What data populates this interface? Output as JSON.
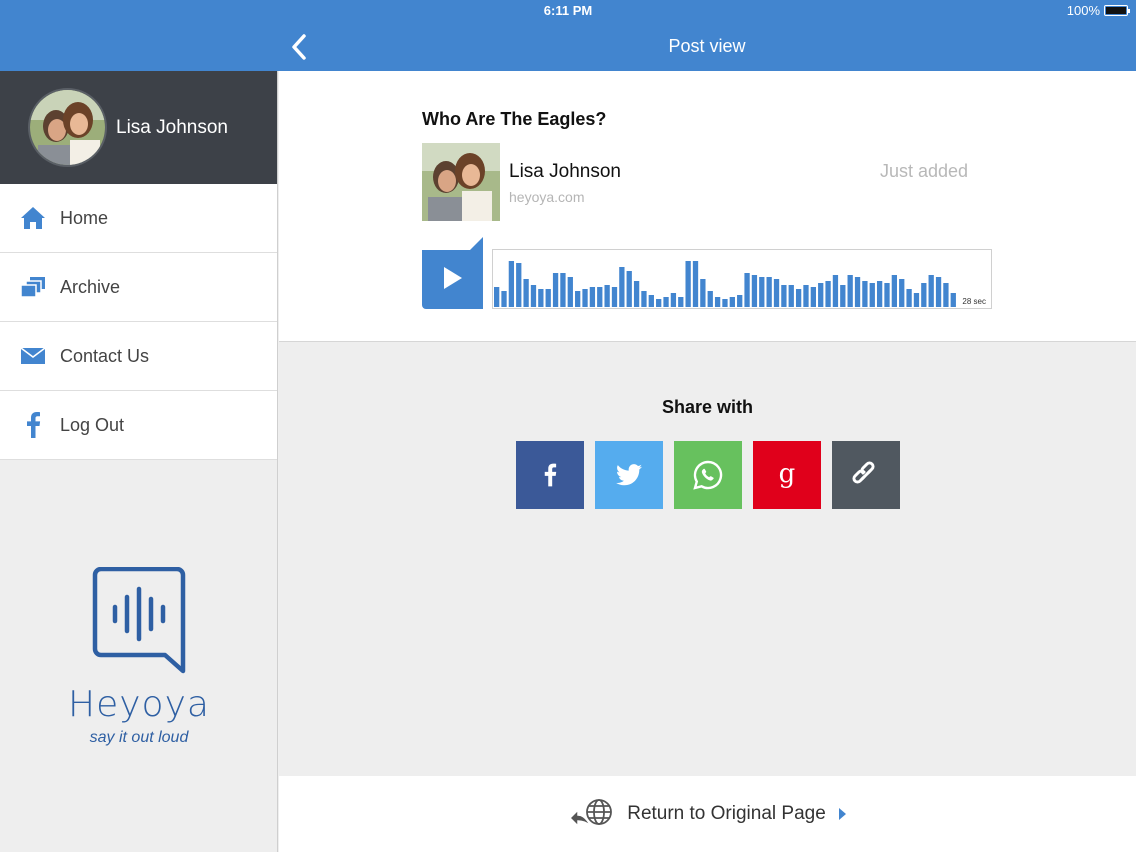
{
  "status_bar": {
    "time": "6:11 PM",
    "battery": "100%"
  },
  "nav": {
    "title": "Post view"
  },
  "profile": {
    "name": "Lisa Johnson"
  },
  "menu": [
    {
      "label": "Home",
      "icon": "home-icon"
    },
    {
      "label": "Archive",
      "icon": "archive-icon"
    },
    {
      "label": "Contact Us",
      "icon": "envelope-icon"
    },
    {
      "label": "Log Out",
      "icon": "facebook-icon"
    }
  ],
  "brand": {
    "name": "Heyoya",
    "tagline": "say it out loud"
  },
  "post": {
    "title": "Who Are The Eagles?",
    "author": "Lisa Johnson",
    "source": "heyoya.com",
    "time": "Just added",
    "duration": "28 sec"
  },
  "share": {
    "title": "Share with",
    "options": [
      {
        "name": "facebook",
        "color": "#3b5998"
      },
      {
        "name": "twitter",
        "color": "#55acee"
      },
      {
        "name": "whatsapp",
        "color": "#67c15e"
      },
      {
        "name": "google-plus",
        "color": "#e0001b"
      },
      {
        "name": "copy-link",
        "color": "#505860"
      }
    ]
  },
  "return": {
    "label": "Return to Original Page"
  },
  "colors": {
    "accent": "#4285cf",
    "sidebar_header": "#3d4148",
    "brand": "#2e5fa3"
  }
}
